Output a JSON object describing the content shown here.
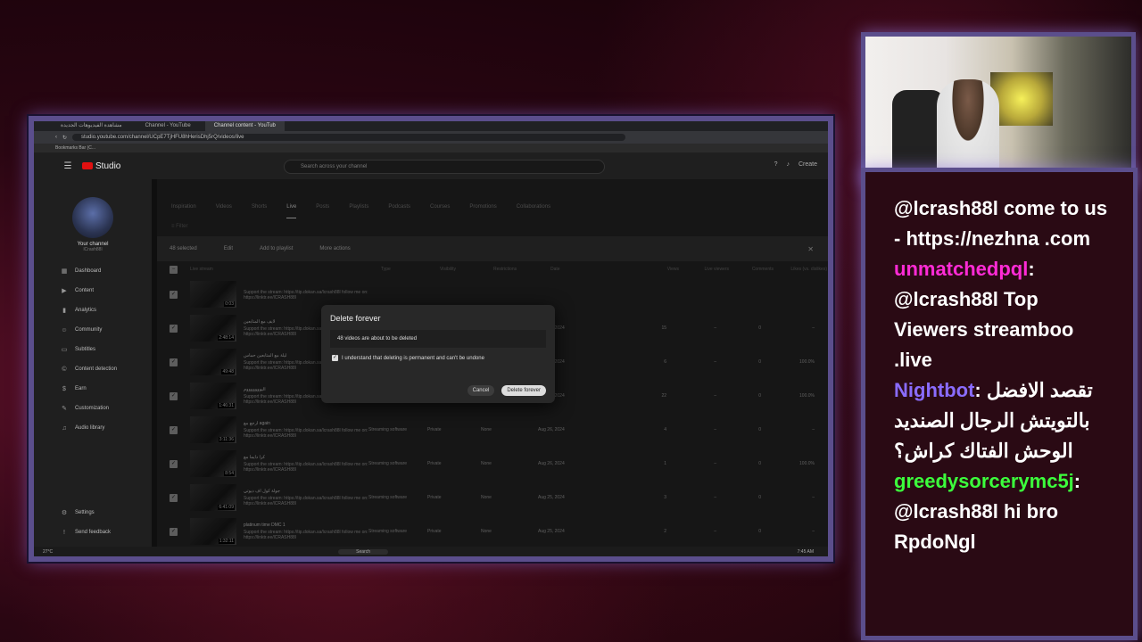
{
  "browser": {
    "tabs": [
      "مشاهدة الفيديوهات الجديدة",
      "Channel - YouTube",
      "Channel content - YouTub"
    ],
    "url": "studio.youtube.com/channel/UCpE7TjHFU8hHerisDhj5rQ/videos/live",
    "bookmarks": "Bookmarks Bar (C..."
  },
  "studio": {
    "logo": "Studio",
    "search_placeholder": "Search across your channel",
    "create_label": "Create",
    "channel_name": "Your channel",
    "channel_handle": "lCrash88l",
    "nav": [
      "Dashboard",
      "Content",
      "Analytics",
      "Community",
      "Subtitles",
      "Content detection",
      "Earn",
      "Customization",
      "Audio library"
    ],
    "nav_bottom": [
      "Settings",
      "Send feedback"
    ],
    "content_tabs": [
      "Inspiration",
      "Videos",
      "Shorts",
      "Live",
      "Posts",
      "Playlists",
      "Podcasts",
      "Courses",
      "Promotions",
      "Collaborations"
    ],
    "filter_label": "Filter",
    "selection": {
      "count": "48 selected",
      "edit": "Edit",
      "playlist": "Add to playlist",
      "more": "More actions"
    },
    "columns": [
      "Live stream",
      "Type",
      "Visibility",
      "Restrictions",
      "Date",
      "Views",
      "Live viewers",
      "Comments",
      "Likes (vs. dislikes)"
    ],
    "rows": [
      {
        "title": "",
        "duration": "0:03",
        "type": "",
        "vis": "",
        "res": "",
        "date": "",
        "views": "",
        "lv": "",
        "com": "",
        "likes": ""
      },
      {
        "title": "لايف مع المتابعين",
        "duration": "2:48:14",
        "type": "",
        "vis": "",
        "res": "",
        "date": "Aug 28, 2024",
        "views": "15",
        "lv": "–",
        "com": "0",
        "likes": "–"
      },
      {
        "title": "ليلة مع المتابعين حماس",
        "duration": "49:48",
        "type": "",
        "vis": "",
        "res": "",
        "date": "Aug 27, 2024",
        "views": "6",
        "lv": "–",
        "com": "0",
        "likes": "100.0%"
      },
      {
        "title": "اليوووووووم",
        "duration": "1:46:31",
        "type": "",
        "vis": "",
        "res": "",
        "date": "Aug 26, 2024",
        "views": "22",
        "lv": "–",
        "com": "0",
        "likes": "100.0%"
      },
      {
        "title": "ارجع مع again",
        "duration": "3:11:36",
        "type": "Streaming software",
        "vis": "Private",
        "res": "None",
        "date": "Aug 26, 2024",
        "views": "4",
        "lv": "–",
        "com": "0",
        "likes": "–"
      },
      {
        "title": "كرا دايما مع",
        "duration": "8:54",
        "type": "Streaming software",
        "vis": "Private",
        "res": "None",
        "date": "Aug 26, 2024",
        "views": "1",
        "lv": "–",
        "com": "0",
        "likes": "100.0%"
      },
      {
        "title": "جولة كول اف ديوتي",
        "duration": "6:41:09",
        "type": "Streaming software",
        "vis": "Private",
        "res": "None",
        "date": "Aug 25, 2024",
        "views": "3",
        "lv": "–",
        "com": "0",
        "likes": "–"
      },
      {
        "title": "platinum time DMC 1",
        "duration": "1:32:11",
        "type": "Streaming software",
        "vis": "Private",
        "res": "None",
        "date": "Aug 25, 2024",
        "views": "2",
        "lv": "–",
        "com": "0",
        "likes": "–"
      }
    ],
    "row_desc": "Support the stream: https://tip.dokan.sa/lcrash88l follow me on: https://linktr.ee/lCRASH88l",
    "row_status": "Streamed"
  },
  "dialog": {
    "title": "Delete forever",
    "message": "48 videos are about to be deleted",
    "checkbox": "I understand that deleting is permanent and can't be undone",
    "cancel": "Cancel",
    "confirm": "Delete forever"
  },
  "taskbar": {
    "weather": "27°C",
    "search": "Search",
    "time": "7:45 AM"
  },
  "chat": [
    {
      "user": "",
      "text": "@lcrash88l come to us - https://nezhna .com",
      "color": "#ffffff"
    },
    {
      "user": "unmatchedpql",
      "text": "@lcrash88l Top Viewers streamboo .live",
      "color": "#ff2bd6"
    },
    {
      "user": "Nightbot",
      "text": "تقصد الافضل بالتويتش الرجال الصنديد الوحش الفتاك كراش؟",
      "color": "#8a6cff"
    },
    {
      "user": "greedysorcerymc5j",
      "text": "@lcrash88l hi bro RpdoNgl",
      "color": "#3cff3c"
    }
  ]
}
